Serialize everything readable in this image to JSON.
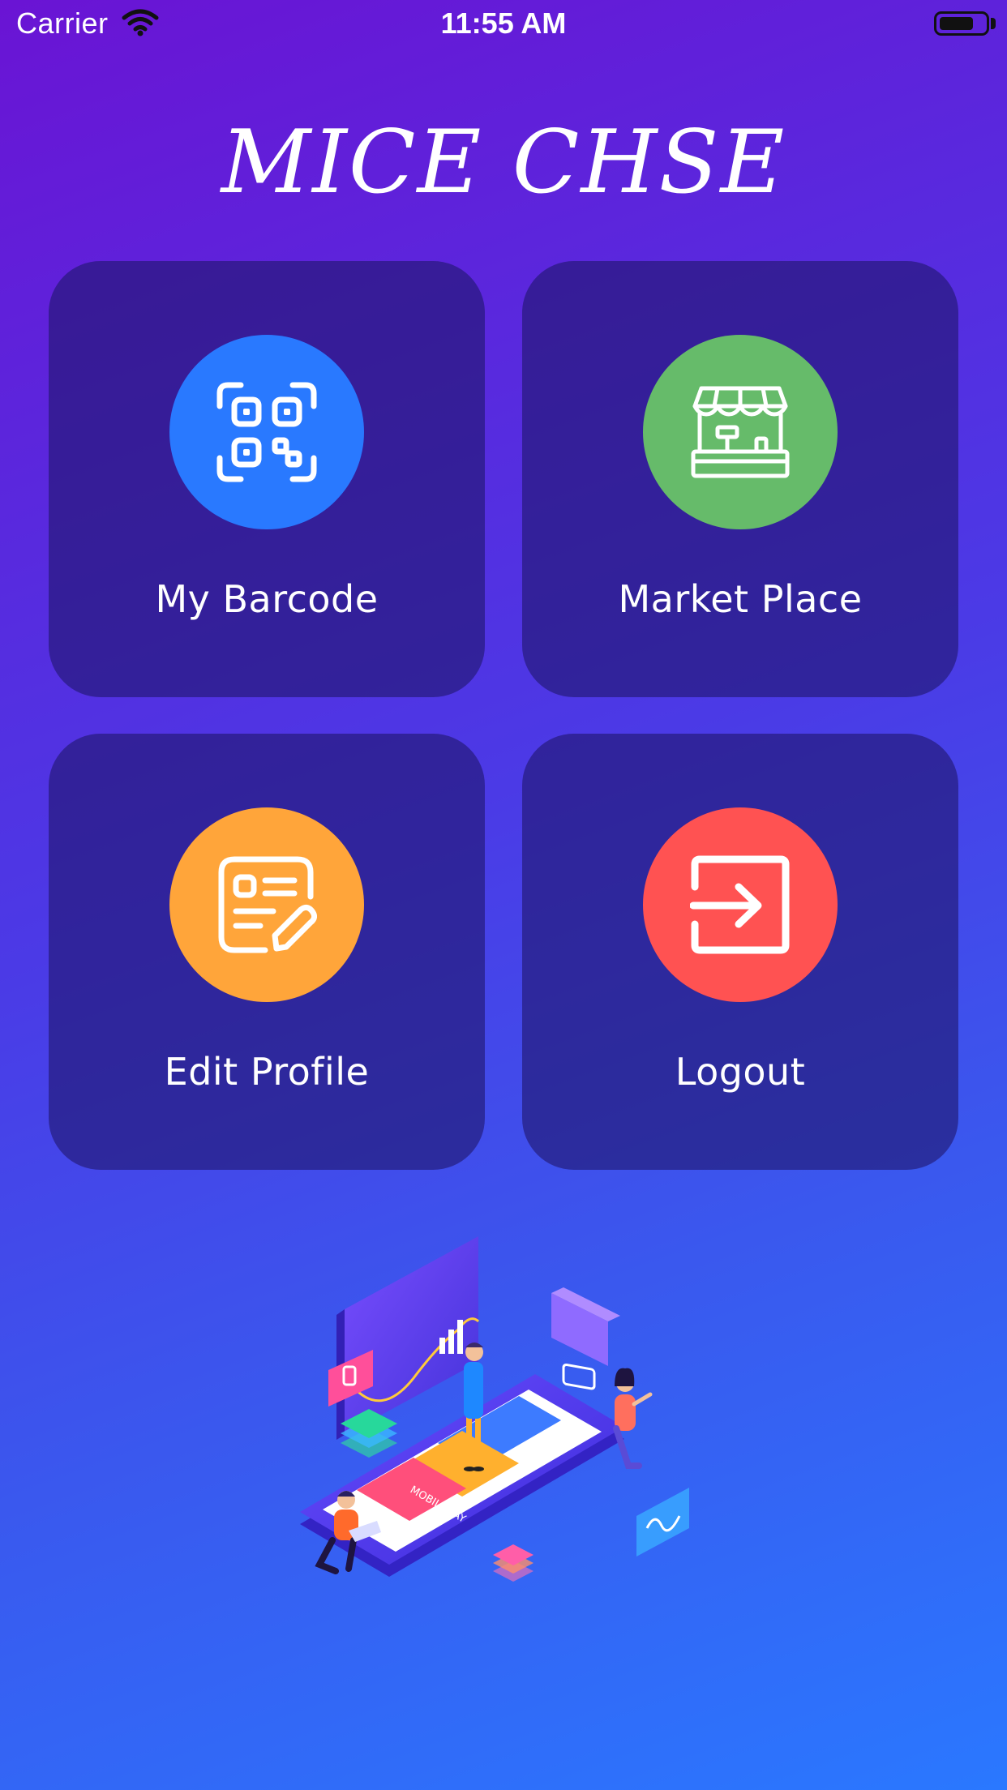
{
  "status_bar": {
    "carrier": "Carrier",
    "time": "11:55 AM",
    "battery_level": 0.75
  },
  "app": {
    "title": "MICE CHSE"
  },
  "menu": {
    "items": [
      {
        "label": "My Barcode",
        "icon": "qr-code-icon",
        "color": "#2979ff"
      },
      {
        "label": "Market Place",
        "icon": "market-stall-icon",
        "color": "#66bb6a"
      },
      {
        "label": "Edit Profile",
        "icon": "edit-profile-icon",
        "color": "#ffa53a"
      },
      {
        "label": "Logout",
        "icon": "logout-icon",
        "color": "#ff5252"
      }
    ]
  },
  "illustration": {
    "card_text": "MOBILE PAY"
  },
  "colors": {
    "gradient_top": "#6a14d4",
    "gradient_bottom": "#2a78ff",
    "card_bg": "rgba(32,22,110,0.62)"
  }
}
